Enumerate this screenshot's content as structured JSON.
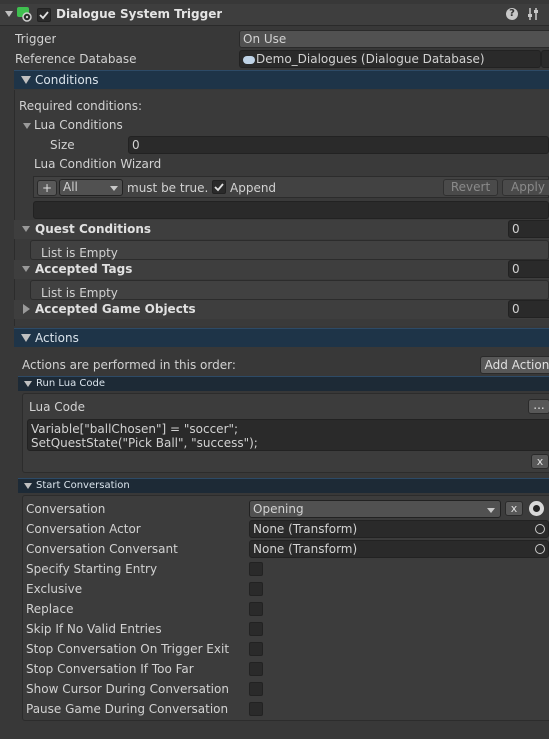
{
  "component": {
    "title": "Dialogue System Trigger",
    "enabled": true,
    "help_icon": "help-icon",
    "settings_icon": "settings-icon"
  },
  "trigger": {
    "label": "Trigger",
    "value": "On Use"
  },
  "reference_database": {
    "label": "Reference Database",
    "value": "Demo_Dialogues (Dialogue Database)"
  },
  "conditions": {
    "header": "Conditions",
    "required_label": "Required conditions:",
    "lua_conditions": {
      "label": "Lua Conditions",
      "size_label": "Size",
      "size_value": "0"
    },
    "wizard": {
      "label": "Lua Condition Wizard",
      "plus": "+",
      "mode": "All",
      "must_be_true": "must be true.",
      "append_label": "Append",
      "append_checked": true,
      "revert": "Revert",
      "apply": "Apply"
    },
    "quest_conditions": {
      "label": "Quest Conditions",
      "count": "0",
      "empty": "List is Empty"
    },
    "accepted_tags": {
      "label": "Accepted Tags",
      "count": "0",
      "empty": "List is Empty"
    },
    "accepted_game_objects": {
      "label": "Accepted Game Objects",
      "count": "0"
    }
  },
  "actions": {
    "header": "Actions",
    "order_label": "Actions are performed in this order:",
    "add_action": "Add Action",
    "run_lua": {
      "header": "Run Lua Code",
      "label": "Lua Code",
      "more": "...",
      "code_lines": [
        "Variable[\"ballChosen\"] = \"soccer\";",
        "SetQuestState(\"Pick Ball\", \"success\");"
      ],
      "remove": "x"
    },
    "start_conversation": {
      "header": "Start Conversation",
      "conversation": {
        "label": "Conversation",
        "value": "Opening",
        "clear": "x"
      },
      "actor": {
        "label": "Conversation Actor",
        "value": "None (Transform)"
      },
      "conversant": {
        "label": "Conversation Conversant",
        "value": "None (Transform)"
      },
      "options": [
        {
          "label": "Specify Starting Entry",
          "checked": false
        },
        {
          "label": "Exclusive",
          "checked": false
        },
        {
          "label": "Replace",
          "checked": false
        },
        {
          "label": "Skip If No Valid Entries",
          "checked": false
        },
        {
          "label": "Stop Conversation On Trigger Exit",
          "checked": false
        },
        {
          "label": "Stop Conversation If Too Far",
          "checked": false
        },
        {
          "label": "Show Cursor During Conversation",
          "checked": false
        },
        {
          "label": "Pause Game During Conversation",
          "checked": false
        }
      ]
    }
  },
  "colors": {
    "background": "#383838",
    "section_bar": "#1e3448",
    "field": "#2a2a2a",
    "accent_icon": "#3fbf4f"
  }
}
